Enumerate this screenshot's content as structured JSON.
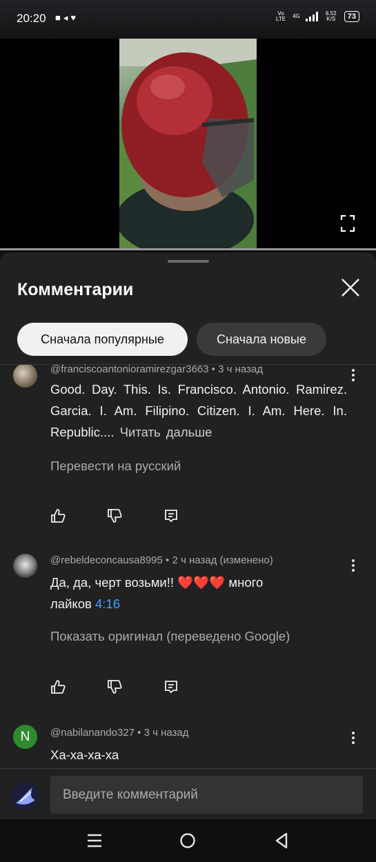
{
  "status_bar": {
    "time": "20:20",
    "left_icons": [
      "video-record-icon",
      "heart-icon"
    ],
    "network_label": "Vo LTE",
    "network_type": "4G",
    "data_speed": "6.52 K/S",
    "battery": "73"
  },
  "player": {
    "progress": 1.0
  },
  "comments_panel": {
    "title": "Комментарии",
    "sort_chips": [
      {
        "label": "Сначала популярные",
        "selected": true
      },
      {
        "label": "Сначала новые",
        "selected": false
      }
    ],
    "comments": [
      {
        "author": "@franciscoantonioramirezgar3663",
        "time": "3 ч назад",
        "text": "Good. Day. This. Is. Francisco. Antonio. Ramirez. Garcia. I. Am. Filipino. Citizen. I. Am. Here. In. Republic....",
        "read_more": "Читать дальше",
        "link": "Перевести на русский"
      },
      {
        "author": "@rebeldeconcausa8995",
        "time": "2 ч назад (изменено)",
        "text": "Да, да, черт возьми!! ❤️❤️❤️ много лайков",
        "timecode": "4:16",
        "link": "Показать оригинал (переведено Google)"
      },
      {
        "author": "@nabilanando327",
        "avatar_letter": "N",
        "time": "3 ч назад",
        "text": "Ха-ха-ха-ха"
      }
    ],
    "input_placeholder": "Введите комментарий"
  },
  "colors": {
    "background": "#0f0f0f",
    "sheet": "#212121",
    "timecode": "#3ea6ff",
    "avatar_n": "#2e8b2e"
  },
  "separator": " • "
}
